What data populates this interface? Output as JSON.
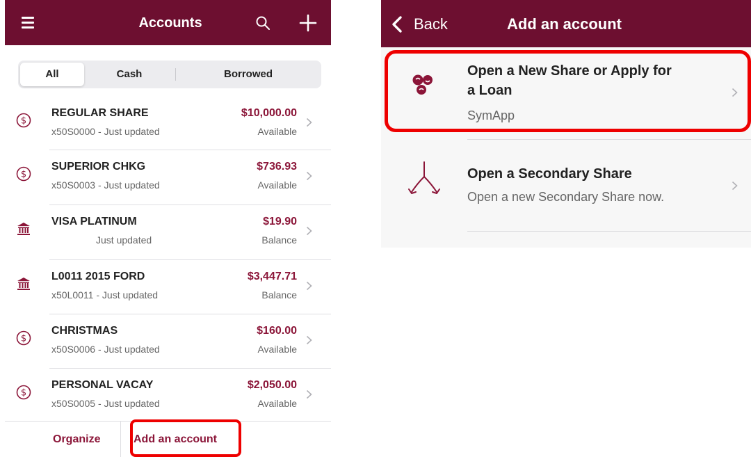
{
  "left_screen": {
    "header": {
      "title": "Accounts",
      "menu_icon": "hamburger-menu-icon",
      "search_icon": "search-icon",
      "add_icon": "plus-icon"
    },
    "tabs": [
      {
        "label": "All",
        "selected": true
      },
      {
        "label": "Cash",
        "selected": false
      },
      {
        "label": "Borrowed",
        "selected": false
      }
    ],
    "accounts": [
      {
        "icon": "dollar-coin-icon",
        "name": "REGULAR SHARE",
        "subtitle": "x50S0000 - Just updated",
        "amount": "$10,000.00",
        "label": "Available"
      },
      {
        "icon": "dollar-coin-icon",
        "name": "SUPERIOR CHKG",
        "subtitle": "x50S0003 - Just updated",
        "amount": "$736.93",
        "label": "Available"
      },
      {
        "icon": "bank-icon",
        "name": "VISA PLATINUM",
        "subtitle": "Just updated",
        "amount": "$19.90",
        "label": "Balance"
      },
      {
        "icon": "bank-icon",
        "name": "L0011 2015 FORD",
        "subtitle": "x50L0011 - Just updated",
        "amount": "$3,447.71",
        "label": "Balance"
      },
      {
        "icon": "dollar-coin-icon",
        "name": "CHRISTMAS",
        "subtitle": "x50S0006 - Just updated",
        "amount": "$160.00",
        "label": "Available"
      },
      {
        "icon": "dollar-coin-icon",
        "name": "PERSONAL VACAY",
        "subtitle": "x50S0005 - Just updated",
        "amount": "$2,050.00",
        "label": "Available"
      }
    ],
    "footer": {
      "organize_label": "Organize",
      "add_account_label": "Add an account"
    }
  },
  "right_screen": {
    "header": {
      "back_label": "Back",
      "title": "Add an account"
    },
    "items": [
      {
        "icon": "symapp-logo-icon",
        "title_line1": "Open a New Share or Apply for",
        "title_line2": "a Loan",
        "subtitle": "SymApp"
      },
      {
        "icon": "split-arrows-icon",
        "title": "Open a Secondary Share",
        "subtitle": "Open a new Secondary Share now."
      }
    ]
  },
  "colors": {
    "brand": "#6d0f30",
    "accent": "#8b1538",
    "highlight": "#ee0000"
  }
}
